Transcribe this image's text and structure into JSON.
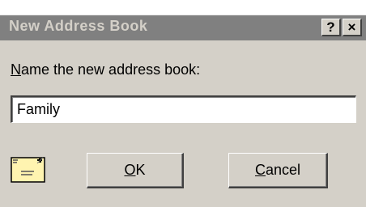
{
  "dialog": {
    "title": "New Address Book",
    "help_button": "?",
    "close_button": "×",
    "prompt_mnemonic": "N",
    "prompt_rest": "ame the new address book:",
    "name_value": "Family",
    "ok_mnemonic": "O",
    "ok_rest": "K",
    "cancel_mnemonic": "C",
    "cancel_rest": "ancel",
    "icon": "address-book-icon"
  },
  "colors": {
    "titlebar_inactive": "#808080",
    "title_text": "#d4d0c8",
    "face": "#d4d0c8",
    "icon_fill": "#fff4b0"
  }
}
